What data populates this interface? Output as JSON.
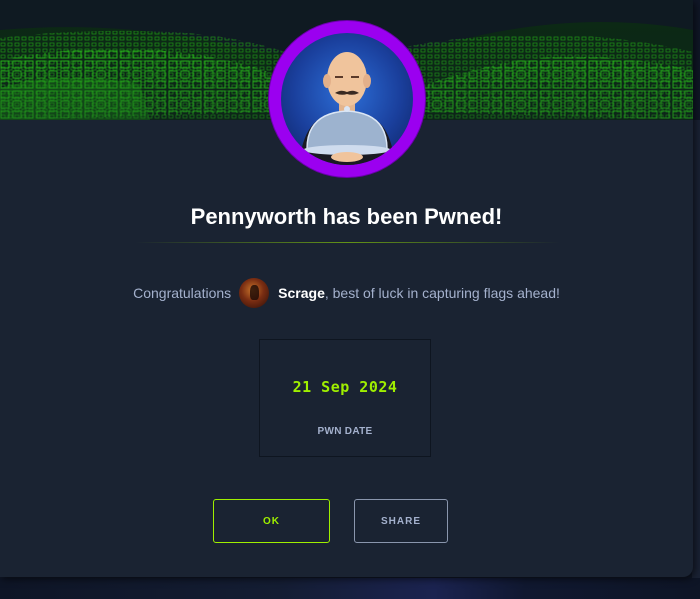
{
  "modal": {
    "title": "Pennyworth has been Pwned!",
    "congrats_prefix": "Congratulations",
    "username": "Scrage",
    "congrats_suffix": ", best of luck in capturing flags ahead!",
    "pwn_date": {
      "value": "21 Sep 2024",
      "label": "PWN DATE"
    },
    "buttons": {
      "ok_label": "OK",
      "share_label": "SHARE"
    }
  },
  "colors": {
    "accent_green": "#9fef00",
    "avatar_ring": "#9b00f0",
    "modal_bg": "#1a2332",
    "text_muted": "#a4b1cd"
  },
  "icons": {
    "machine_avatar": "butler-avatar",
    "user_avatar": "user-avatar"
  }
}
